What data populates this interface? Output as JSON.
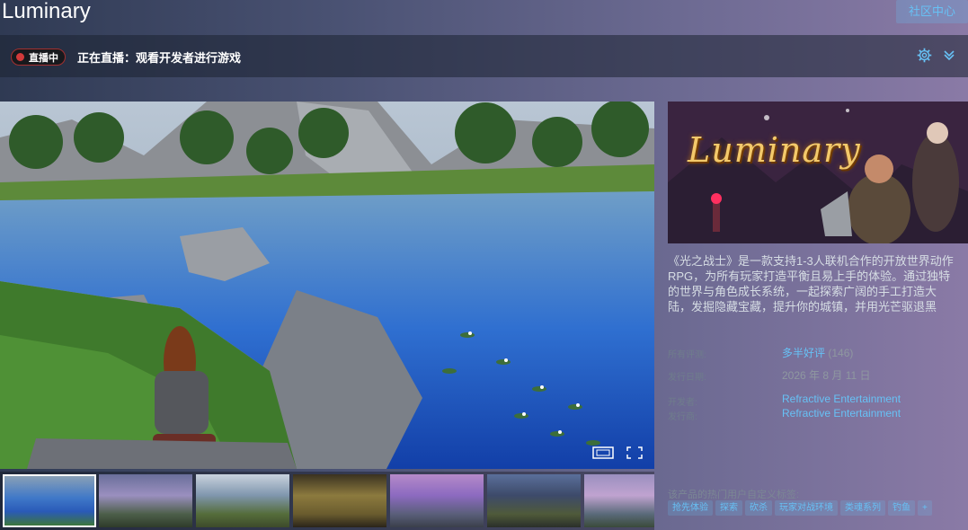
{
  "header": {
    "title": "Luminary",
    "community_button": "社区中心"
  },
  "live": {
    "badge": "直播中",
    "text": "正在直播：观看开发者进行游戏"
  },
  "capsule": {
    "logo_text": "Luminary"
  },
  "description": "《光之战士》是一款支持1-3人联机合作的开放世界动作RPG，为所有玩家打造平衡且易上手的体验。通过独特的世界与角色成长系统，一起探索广阔的手工打造大陆，发掘隐藏宝藏，提升你的城镇，并用光芒驱退黑",
  "info": {
    "reviews_label": "所有评测:",
    "reviews_value": "多半好评",
    "reviews_count": "(146)",
    "release_label": "发行日期:",
    "release_value": "2026 年 8 月 11 日",
    "developer_label": "开发者:",
    "developer_value": "Refractive Entertainment",
    "publisher_label": "发行商:",
    "publisher_value": "Refractive Entertainment"
  },
  "tags": {
    "label": "该产品的热门用户自定义标签:",
    "items": [
      "抢先体验",
      "探索",
      "砍杀",
      "玩家对战环境",
      "类魂系列",
      "钓鱼",
      "+"
    ]
  },
  "colors": {
    "accent": "#67c1f5",
    "live_red": "#d23a3a"
  },
  "icons": [
    "gear-icon",
    "chevron-down-icon",
    "fullscreen-icon",
    "screenshot-icon"
  ]
}
